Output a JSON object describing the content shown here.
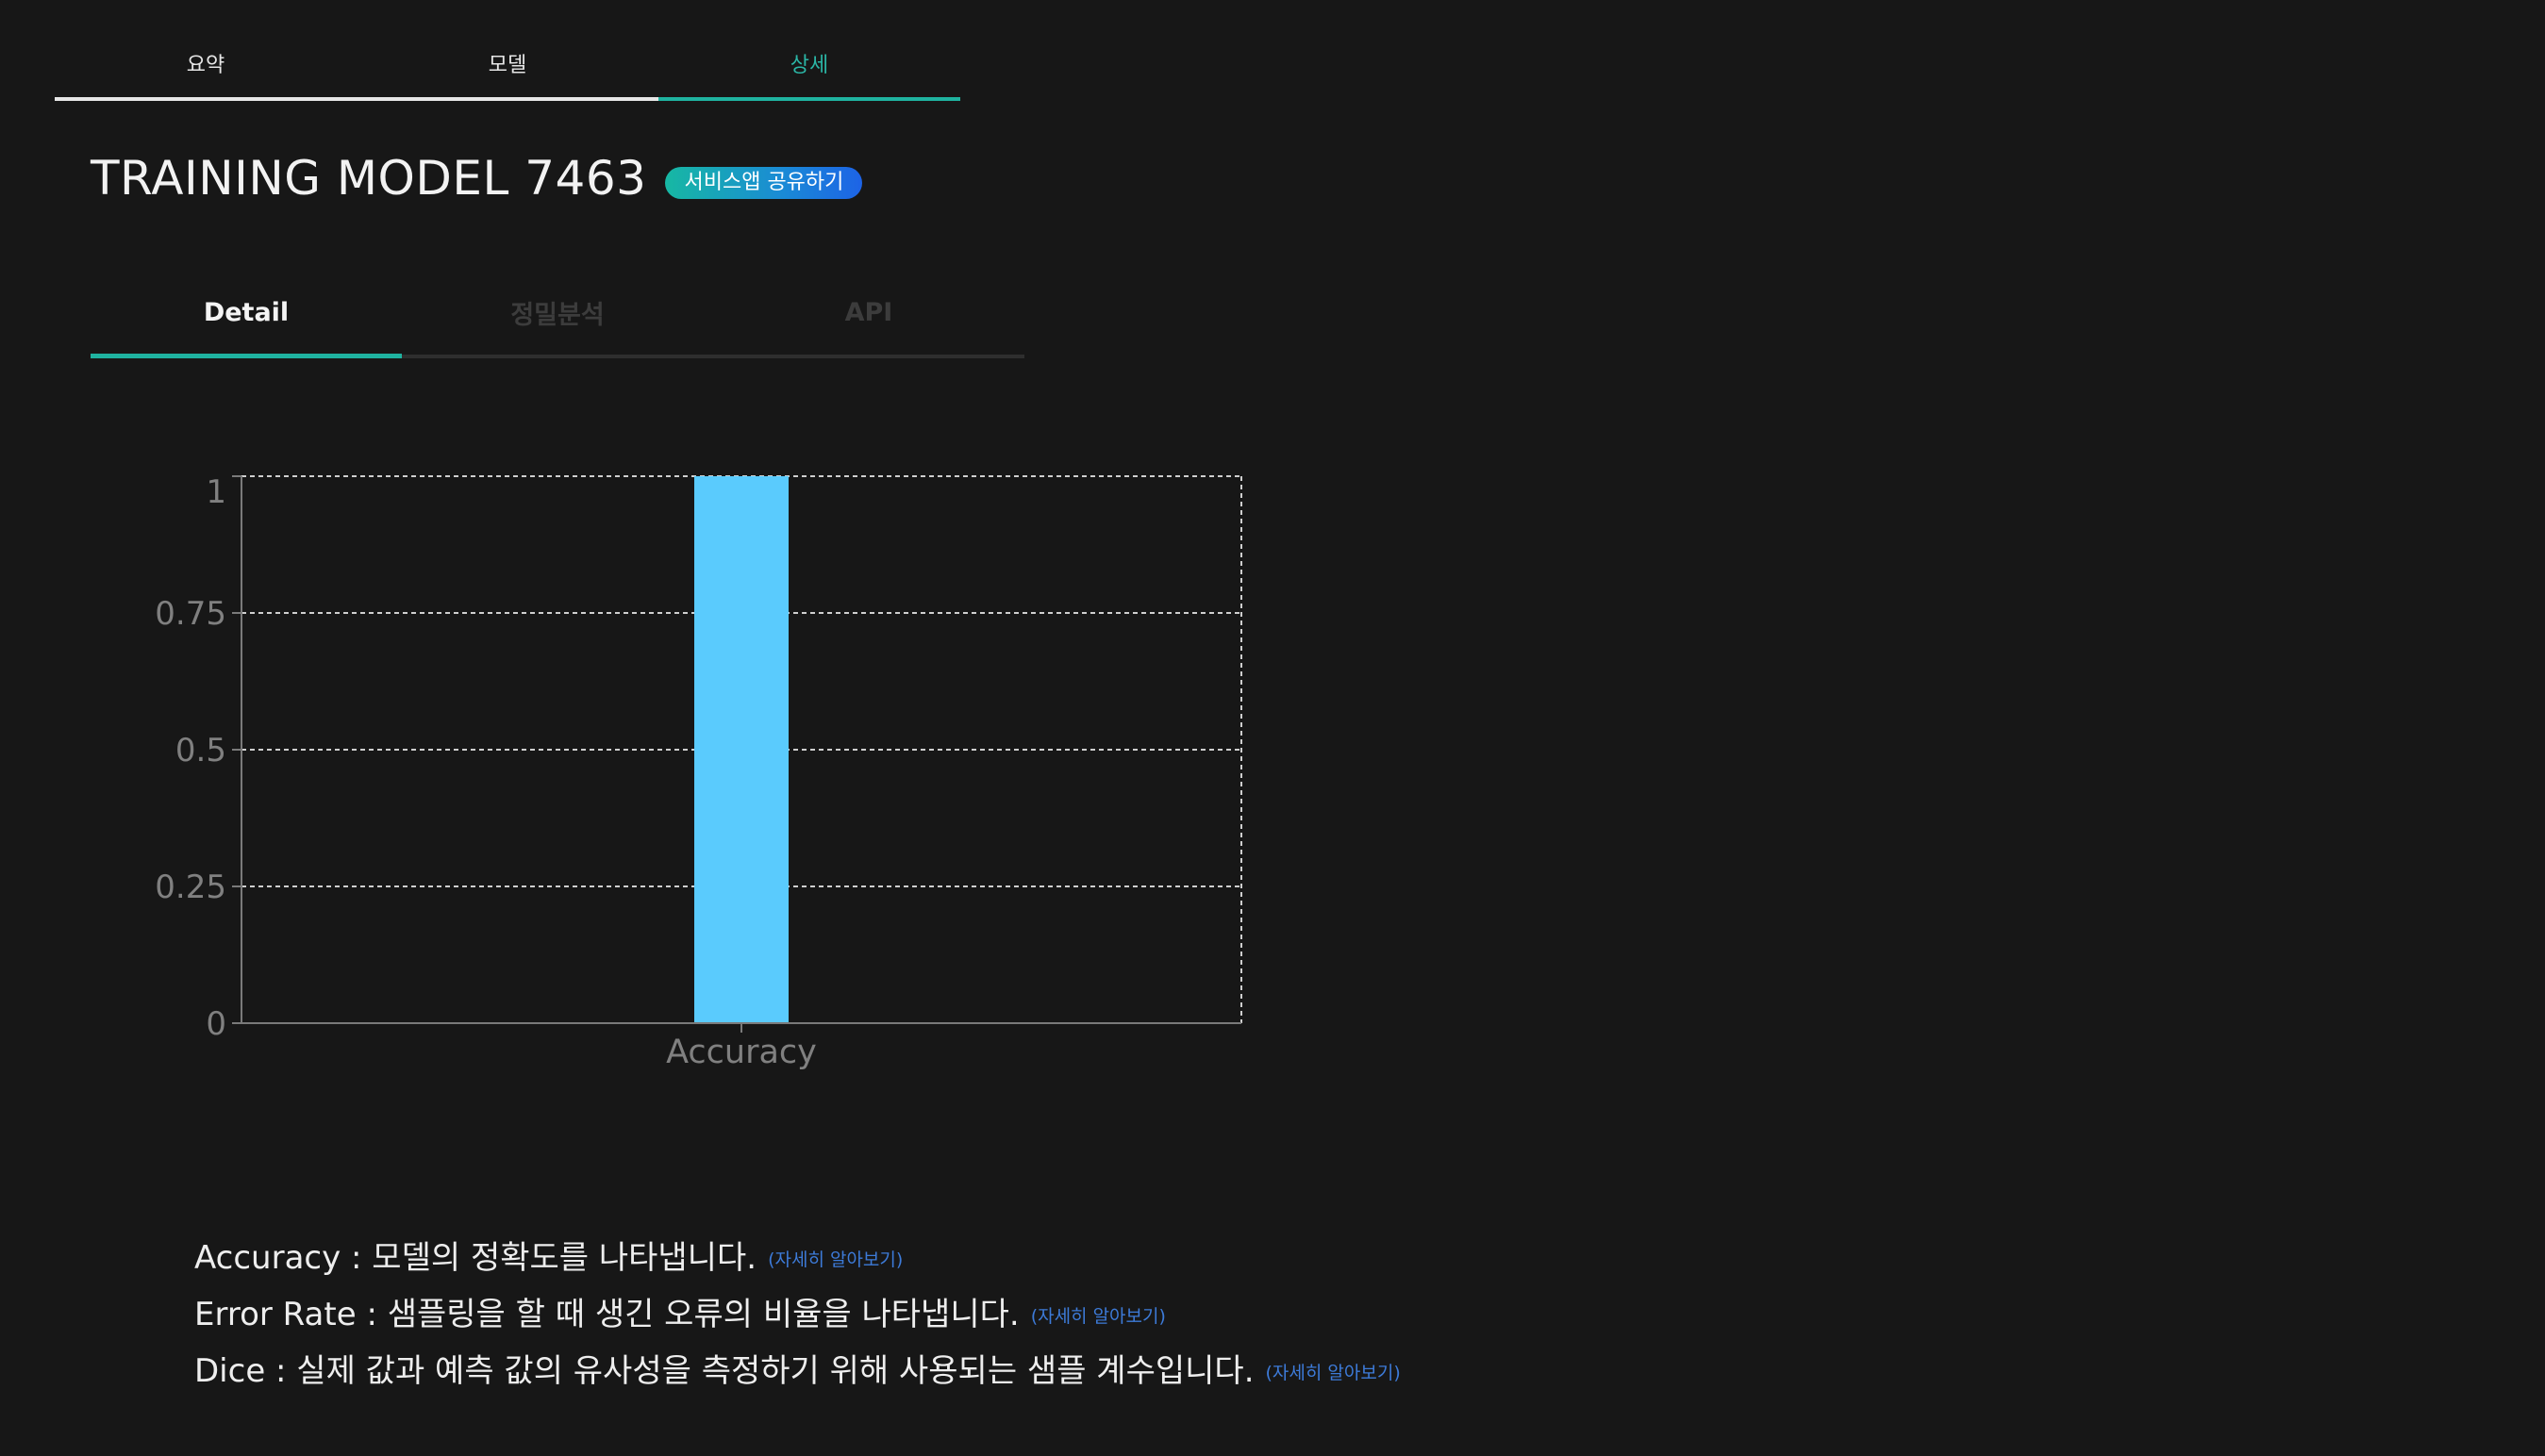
{
  "top_tabs": [
    {
      "label": "요약"
    },
    {
      "label": "모델"
    },
    {
      "label": "상세"
    }
  ],
  "title": "TRAINING MODEL 7463",
  "share_label": "서비스앱 공유하기",
  "sub_tabs": [
    {
      "label": "Detail"
    },
    {
      "label": "정밀분석"
    },
    {
      "label": "API"
    }
  ],
  "chart_data": {
    "type": "bar",
    "categories": [
      "Accuracy"
    ],
    "values": [
      1
    ],
    "ylim": [
      0,
      1
    ],
    "yticks": [
      "0",
      "0.25",
      "0.5",
      "0.75",
      "1"
    ],
    "grid": true,
    "bar_color": "#5acbfd"
  },
  "descriptions": [
    {
      "text": "Accuracy : 모델의 정확도를 나타냅니다.",
      "more": "(자세히 알아보기)"
    },
    {
      "text": "Error Rate : 샘플링을 할 때 생긴 오류의 비율을 나타냅니다.",
      "more": "(자세히 알아보기)"
    },
    {
      "text": "Dice : 실제 값과 예측 값의 유사성을 측정하기 위해 사용되는 샘플 계수입니다.",
      "more": "(자세히 알아보기)"
    }
  ],
  "colors": {
    "accent": "#1fb3a0",
    "link": "#3d7bd9",
    "background": "#171717"
  }
}
